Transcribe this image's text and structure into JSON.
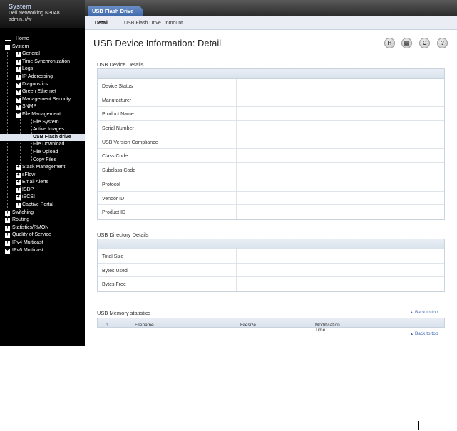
{
  "system": {
    "title": "System",
    "model": "Dell Networking N3048",
    "user": "admin, r/w"
  },
  "nav": [
    {
      "label": "Home",
      "level": 0,
      "icon": "home"
    },
    {
      "label": "System",
      "level": 0,
      "icon": "minus"
    },
    {
      "label": "General",
      "level": 1,
      "icon": "plus"
    },
    {
      "label": "Time Synchronization",
      "level": 1,
      "icon": "plus"
    },
    {
      "label": "Logs",
      "level": 1,
      "icon": "plus"
    },
    {
      "label": "IP Addressing",
      "level": 1,
      "icon": "plus"
    },
    {
      "label": "Diagnostics",
      "level": 1,
      "icon": "plus"
    },
    {
      "label": "Green Ethernet",
      "level": 1,
      "icon": "plus"
    },
    {
      "label": "Management Security",
      "level": 1,
      "icon": "plus"
    },
    {
      "label": "SNMP",
      "level": 1,
      "icon": "plus"
    },
    {
      "label": "File Management",
      "level": 1,
      "icon": "minus"
    },
    {
      "label": "File System",
      "level": 2,
      "icon": "none"
    },
    {
      "label": "Active Images",
      "level": 2,
      "icon": "none"
    },
    {
      "label": "USB Flash drive",
      "level": 2,
      "icon": "none",
      "selected": true
    },
    {
      "label": "File Download",
      "level": 2,
      "icon": "none"
    },
    {
      "label": "File Upload",
      "level": 2,
      "icon": "none"
    },
    {
      "label": "Copy Files",
      "level": 2,
      "icon": "none"
    },
    {
      "label": "Stack Management",
      "level": 1,
      "icon": "plus"
    },
    {
      "label": "sFlow",
      "level": 1,
      "icon": "plus"
    },
    {
      "label": "Email Alerts",
      "level": 1,
      "icon": "plus"
    },
    {
      "label": "ISDP",
      "level": 1,
      "icon": "plus"
    },
    {
      "label": "iSCSI",
      "level": 1,
      "icon": "plus"
    },
    {
      "label": "Captive Portal",
      "level": 1,
      "icon": "plus"
    },
    {
      "label": "Switching",
      "level": 0,
      "icon": "plus"
    },
    {
      "label": "Routing",
      "level": 0,
      "icon": "plus"
    },
    {
      "label": "Statistics/RMON",
      "level": 0,
      "icon": "plus"
    },
    {
      "label": "Quality of Service",
      "level": 0,
      "icon": "plus"
    },
    {
      "label": "IPv4 Multicast",
      "level": 0,
      "icon": "plus"
    },
    {
      "label": "IPv6 Multicast",
      "level": 0,
      "icon": "plus"
    }
  ],
  "tab": {
    "label": "USB Flash Drive"
  },
  "subtabs": {
    "detail": "Detail",
    "unmount": "USB Flash Drive Unmount"
  },
  "page_title": "USB Device Information: Detail",
  "toolbar_icons": [
    "save-icon",
    "print-icon",
    "refresh-icon",
    "help-icon"
  ],
  "device_details": {
    "title": "USB Device Details",
    "rows": [
      "Device Status",
      "Manufacturer",
      "Product Name",
      "Serial Number",
      "USB Version Compliance",
      "Class Code",
      "Subclass Code",
      "Protocol",
      "Vendor ID",
      "Product ID"
    ]
  },
  "directory_details": {
    "title": "USB Directory Details",
    "rows": [
      "Total Size",
      "Bytes Used",
      "Bytes Free"
    ]
  },
  "memory_stats": {
    "title": "USB Memory statistics",
    "columns": [
      "Filename",
      "Filesize",
      "Modification Time"
    ]
  },
  "back_to_top": "Back to top",
  "colors": {
    "accent": "#3f69aa",
    "sidebar_bg": "#000000",
    "link": "#3a66b0"
  }
}
